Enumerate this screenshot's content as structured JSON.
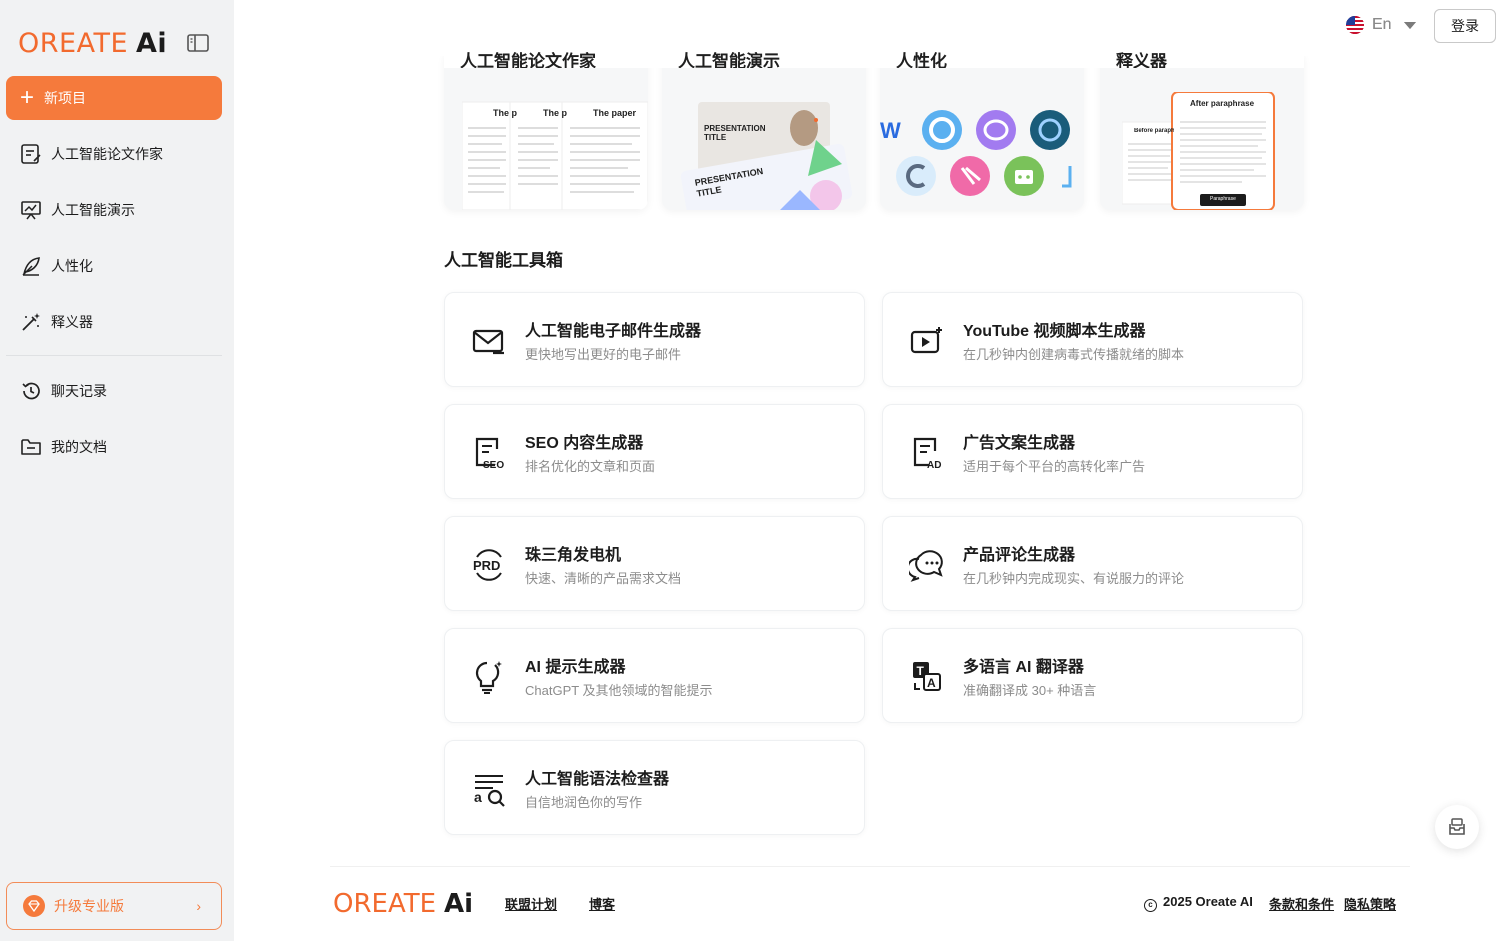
{
  "sidebar": {
    "logo_main": "OREATE",
    "logo_ai": "Ai",
    "new_project": "新项目",
    "items": [
      {
        "label": "人工智能论文作家",
        "icon": "document-edit-icon"
      },
      {
        "label": "人工智能演示",
        "icon": "presentation-icon"
      },
      {
        "label": "人性化",
        "icon": "feather-icon"
      },
      {
        "label": "释义器",
        "icon": "magic-wand-icon"
      },
      {
        "label": "聊天记录",
        "icon": "history-icon"
      },
      {
        "label": "我的文档",
        "icon": "folder-icon"
      }
    ],
    "upgrade_label": "升级专业版"
  },
  "topbar": {
    "language": "En",
    "login": "登录"
  },
  "feature_cards": [
    {
      "title": "人工智能论文作家",
      "preview": {
        "col1": "The p",
        "col2": "The p",
        "col3": "The paper"
      }
    },
    {
      "title": "人工智能演示",
      "preview": {
        "slide1": "PRESENTATION TITLE",
        "slide2": "PRESENTATION TITLE"
      }
    },
    {
      "title": "人性化"
    },
    {
      "title": "释义器",
      "preview": {
        "after": "After paraphrase",
        "before": "Before paraph",
        "button": "Paraphrase"
      }
    }
  ],
  "toolbox": {
    "title": "人工智能工具箱",
    "tools": [
      {
        "title": "人工智能电子邮件生成器",
        "desc": "更快地写出更好的电子邮件",
        "icon": "email-icon"
      },
      {
        "title": "YouTube 视频脚本生成器",
        "desc": "在几秒钟内创建病毒式传播就绪的脚本",
        "icon": "video-icon"
      },
      {
        "title": "SEO 内容生成器",
        "desc": "排名优化的文章和页面",
        "icon": "seo-icon"
      },
      {
        "title": "广告文案生成器",
        "desc": "适用于每个平台的高转化率广告",
        "icon": "ad-icon"
      },
      {
        "title": "珠三角发电机",
        "desc": "快速、清晰的产品需求文档",
        "icon": "prd-icon"
      },
      {
        "title": "产品评论生成器",
        "desc": "在几秒钟内完成现实、有说服力的评论",
        "icon": "chat-bubbles-icon"
      },
      {
        "title": "AI 提示生成器",
        "desc": "ChatGPT 及其他领域的智能提示",
        "icon": "lightbulb-icon"
      },
      {
        "title": "多语言 AI 翻译器",
        "desc": "准确翻译成 30+ 种语言",
        "icon": "translate-icon"
      },
      {
        "title": "人工智能语法检查器",
        "desc": "自信地润色你的写作",
        "icon": "grammar-check-icon"
      }
    ]
  },
  "footer": {
    "logo_main": "OREATE",
    "logo_ai": "Ai",
    "affiliate": "联盟计划",
    "blog": "博客",
    "copyright": "2025 Oreate AI",
    "terms": "条款和条件",
    "privacy": "隐私策略"
  },
  "colors": {
    "accent": "#f57a3c",
    "sidebar_bg": "#f1f2f3"
  }
}
